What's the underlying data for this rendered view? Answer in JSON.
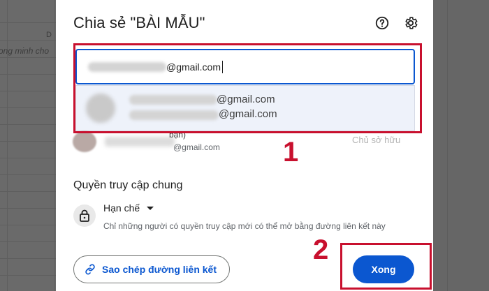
{
  "background": {
    "left_cell_text": "ong minh cho",
    "column_letter": "D"
  },
  "dialog": {
    "title": "Chia sẻ \"BÀI MẪU\"",
    "help_icon": "help-circle-icon",
    "settings_icon": "gear-icon"
  },
  "email_input": {
    "value_visible": "@gmail.com"
  },
  "suggestion": {
    "line1": "@gmail.com",
    "line2": "@gmail.com"
  },
  "owner": {
    "name_tail": "bạn)",
    "email": "@gmail.com",
    "role": "Chủ sở hữu"
  },
  "general_access": {
    "title": "Quyền truy cập chung",
    "selected": "Hạn chế",
    "description": "Chỉ những người có quyền truy cập mới có thể mở bằng đường liên kết này"
  },
  "footer": {
    "copy_link_label": "Sao chép đường liên kết",
    "done_label": "Xong"
  },
  "annotations": {
    "label_1": "1",
    "label_2": "2"
  },
  "colors": {
    "primary": "#0b57d0",
    "annotation_red": "#c8102e"
  }
}
